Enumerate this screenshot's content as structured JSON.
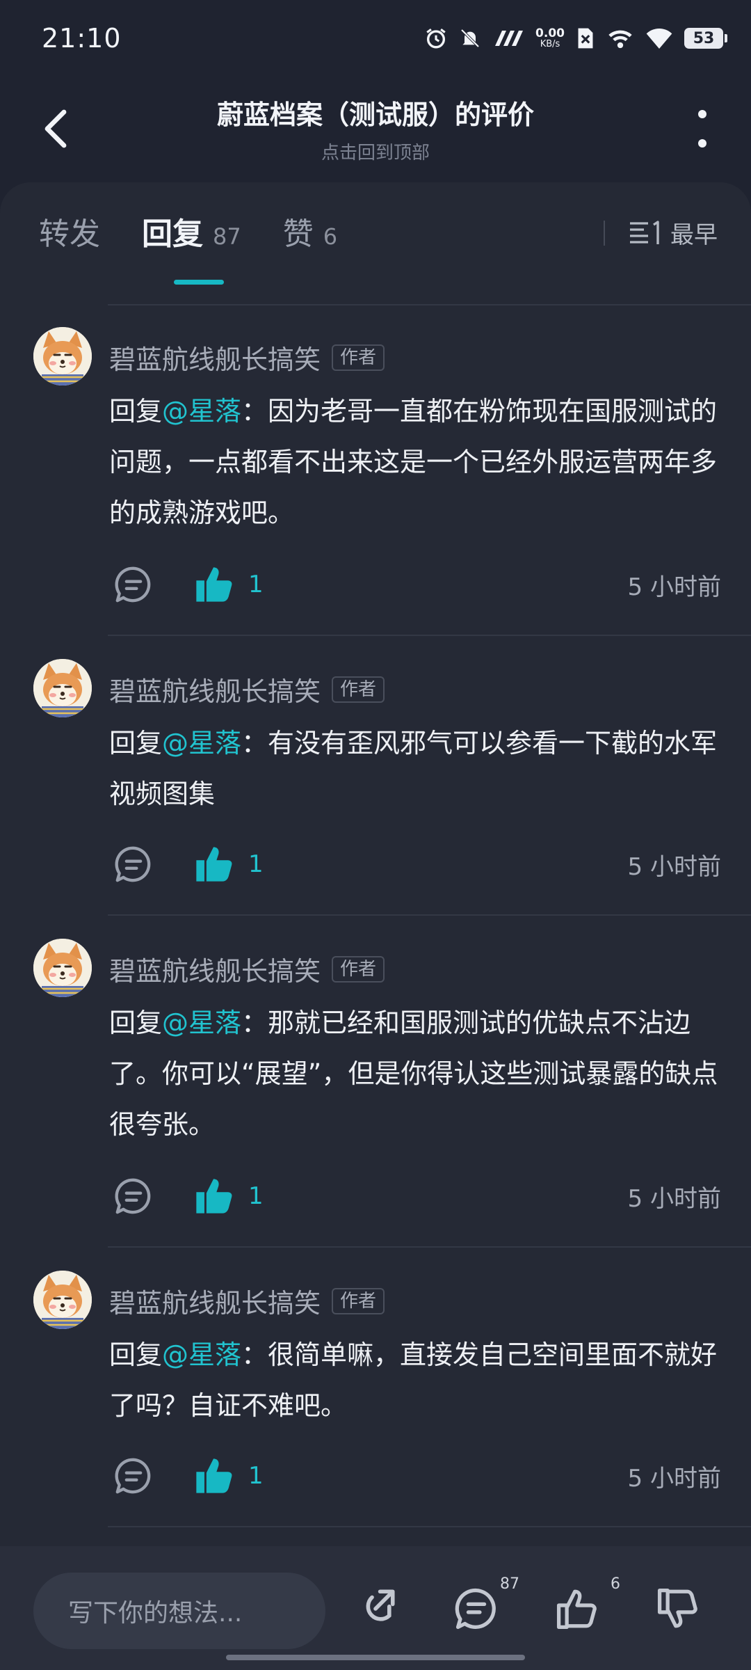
{
  "status": {
    "time": "21:10",
    "net_speed_value": "0.00",
    "net_speed_unit": "KB/s",
    "battery": "53"
  },
  "header": {
    "title": "蔚蓝档案（测试服）的评价",
    "subtitle": "点击回到顶部"
  },
  "tabs": [
    {
      "label": "转发",
      "count": ""
    },
    {
      "label": "回复",
      "count": "87"
    },
    {
      "label": "赞",
      "count": "6"
    }
  ],
  "sort": {
    "label": "最早"
  },
  "comments": [
    {
      "author": "碧蓝航线舰长搞笑",
      "badge": "作者",
      "reply_prefix": "回复",
      "mention": "@星落",
      "text": "：因为老哥一直都在粉饰现在国服测试的问题，一点都看不出来这是一个已经外服运营两年多的成熟游戏吧。",
      "likes": "1",
      "time": "5 小时前"
    },
    {
      "author": "碧蓝航线舰长搞笑",
      "badge": "作者",
      "reply_prefix": "回复",
      "mention": "@星落",
      "text": "：有没有歪风邪气可以参看一下截的水军视频图集",
      "likes": "1",
      "time": "5 小时前"
    },
    {
      "author": "碧蓝航线舰长搞笑",
      "badge": "作者",
      "reply_prefix": "回复",
      "mention": "@星落",
      "text": "：那就已经和国服测试的优缺点不沾边了。你可以“展望”，但是你得认这些测试暴露的缺点很夸张。",
      "likes": "1",
      "time": "5 小时前"
    },
    {
      "author": "碧蓝航线舰长搞笑",
      "badge": "作者",
      "reply_prefix": "回复",
      "mention": "@星落",
      "text": "：很简单嘛，直接发自己空间里面不就好了吗？自证不难吧。",
      "likes": "1",
      "time": "5 小时前"
    }
  ],
  "bottom": {
    "placeholder": "写下你的想法...",
    "comment_count": "87",
    "like_count": "6"
  },
  "colors": {
    "accent": "#17b8c4",
    "background": "#1f2330",
    "card": "#252935"
  }
}
